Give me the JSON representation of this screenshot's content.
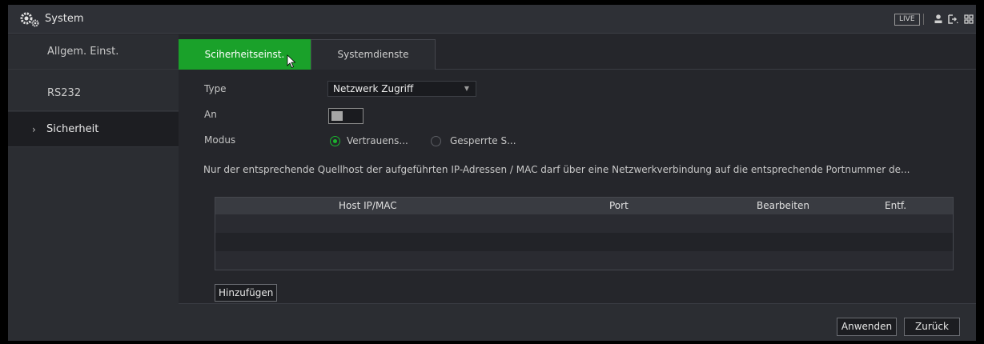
{
  "titlebar": {
    "title": "System",
    "live_label": "LIVE"
  },
  "sidebar": {
    "items": [
      {
        "label": "Allgem. Einst."
      },
      {
        "label": "RS232"
      },
      {
        "label": "Sicherheit",
        "chevron": "›"
      }
    ]
  },
  "tabs": [
    {
      "label": "Sciherheitseinst."
    },
    {
      "label": "Systemdienste"
    }
  ],
  "form": {
    "type_label": "Type",
    "type_value": "Netzwerk Zugriff",
    "an_label": "An",
    "an_enabled": false,
    "modus_label": "Modus",
    "modus_options": [
      "Vertrauens...",
      "Gesperrte S..."
    ],
    "modus_selected": "Vertrauens...",
    "info_text": "Nur der entsprechende Quellhost der aufgeführten IP-Adressen / MAC darf über eine Netzwerkverbindung auf die entsprechende Portnummer de..."
  },
  "table": {
    "columns": [
      "Host IP/MAC",
      "Port",
      "Bearbeiten",
      "Entf."
    ],
    "rows": []
  },
  "buttons": {
    "add": "Hinzufügen",
    "apply": "Anwenden",
    "back": "Zurück"
  },
  "colors": {
    "accent": "#1aa12a",
    "radio_on": "#1bb52e"
  },
  "icons": [
    "settings-gears-icon",
    "user-icon",
    "logout-icon",
    "grid-menu-icon",
    "mouse-cursor-icon"
  ]
}
